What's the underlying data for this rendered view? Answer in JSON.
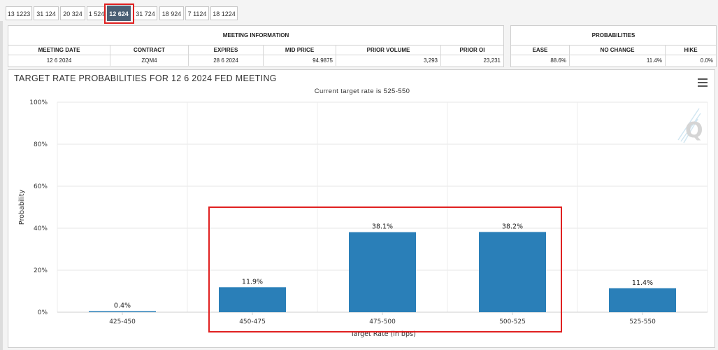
{
  "tabs": [
    {
      "label": "13 1223"
    },
    {
      "label": "31 124"
    },
    {
      "label": "20 324"
    },
    {
      "label": "1 524"
    },
    {
      "label": "12 624"
    },
    {
      "label": "31 724"
    },
    {
      "label": "18 924"
    },
    {
      "label": "7 1124"
    },
    {
      "label": "18 1224"
    }
  ],
  "active_tab": "12 624",
  "meeting_info": {
    "title": "MEETING INFORMATION",
    "headers": {
      "date": "MEETING DATE",
      "contract": "CONTRACT",
      "expires": "EXPIRES",
      "mid_price": "MID PRICE",
      "prior_volume": "PRIOR VOLUME",
      "prior_oi": "PRIOR OI"
    },
    "values": {
      "date": "12 6 2024",
      "contract": "ZQM4",
      "expires": "28 6 2024",
      "mid_price": "94.9875",
      "prior_volume": "3,293",
      "prior_oi": "23,231"
    }
  },
  "probabilities": {
    "title": "PROBABILITIES",
    "headers": {
      "ease": "EASE",
      "no_change": "NO CHANGE",
      "hike": "HIKE"
    },
    "values": {
      "ease": "88.6%",
      "no_change": "11.4%",
      "hike": "0.0%"
    }
  },
  "chart": {
    "title": "TARGET RATE PROBABILITIES FOR 12 6 2024 FED MEETING",
    "subtitle": "Current target rate is 525-550",
    "bar_color": "#2a7fb8",
    "highlight_color": "#e02020"
  },
  "chart_data": {
    "type": "bar",
    "categories": [
      "425-450",
      "450-475",
      "475-500",
      "500-525",
      "525-550"
    ],
    "values": [
      0.4,
      11.9,
      38.1,
      38.2,
      11.4
    ],
    "data_labels": [
      "0.4%",
      "11.9%",
      "38.1%",
      "38.2%",
      "11.4%"
    ],
    "ylabel": "Probability",
    "xlabel": "Target Rate (in bps)",
    "ylim": [
      0,
      100
    ],
    "yticks": [
      "0%",
      "20%",
      "40%",
      "60%",
      "80%",
      "100%"
    ],
    "grid": true,
    "legend": "none"
  }
}
